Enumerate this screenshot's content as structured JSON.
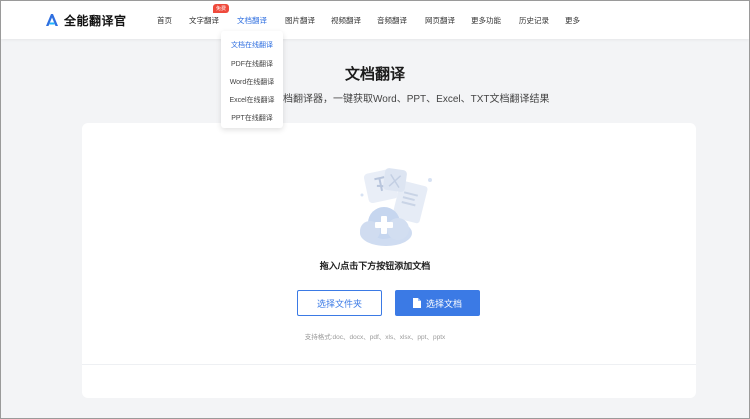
{
  "app": {
    "name": "全能翻译官",
    "accent": "#2f6fe0",
    "badge_color": "#ef4a3c"
  },
  "nav": {
    "items": [
      {
        "label": "首页"
      },
      {
        "label": "文字翻译",
        "badge": "免费"
      },
      {
        "label": "文档翻译"
      },
      {
        "label": "图片翻译"
      },
      {
        "label": "视频翻译"
      },
      {
        "label": "音频翻译"
      },
      {
        "label": "网页翻译"
      },
      {
        "label": "更多功能"
      },
      {
        "label": "历史记录"
      },
      {
        "label": "更多"
      }
    ]
  },
  "dropdown": {
    "items": [
      {
        "label": "文档在线翻译"
      },
      {
        "label": "PDF在线翻译"
      },
      {
        "label": "Word在线翻译"
      },
      {
        "label": "Excel在线翻译"
      },
      {
        "label": "PPT在线翻译"
      }
    ]
  },
  "main": {
    "title": "文档翻译",
    "subtitle": "档翻译器，一键获取Word、PPT、Excel、TXT文档翻译结果"
  },
  "upload": {
    "drop_text": "拖入/点击下方按钮添加文档",
    "folder_button": "选择文件夹",
    "doc_button": "选择文档",
    "formats": "支持格式:doc、docx、pdf、xls、xlsx、ppt、pptx",
    "illustration_icons": [
      "cloud-upload-icon",
      "document-icon",
      "plus-icon"
    ]
  }
}
